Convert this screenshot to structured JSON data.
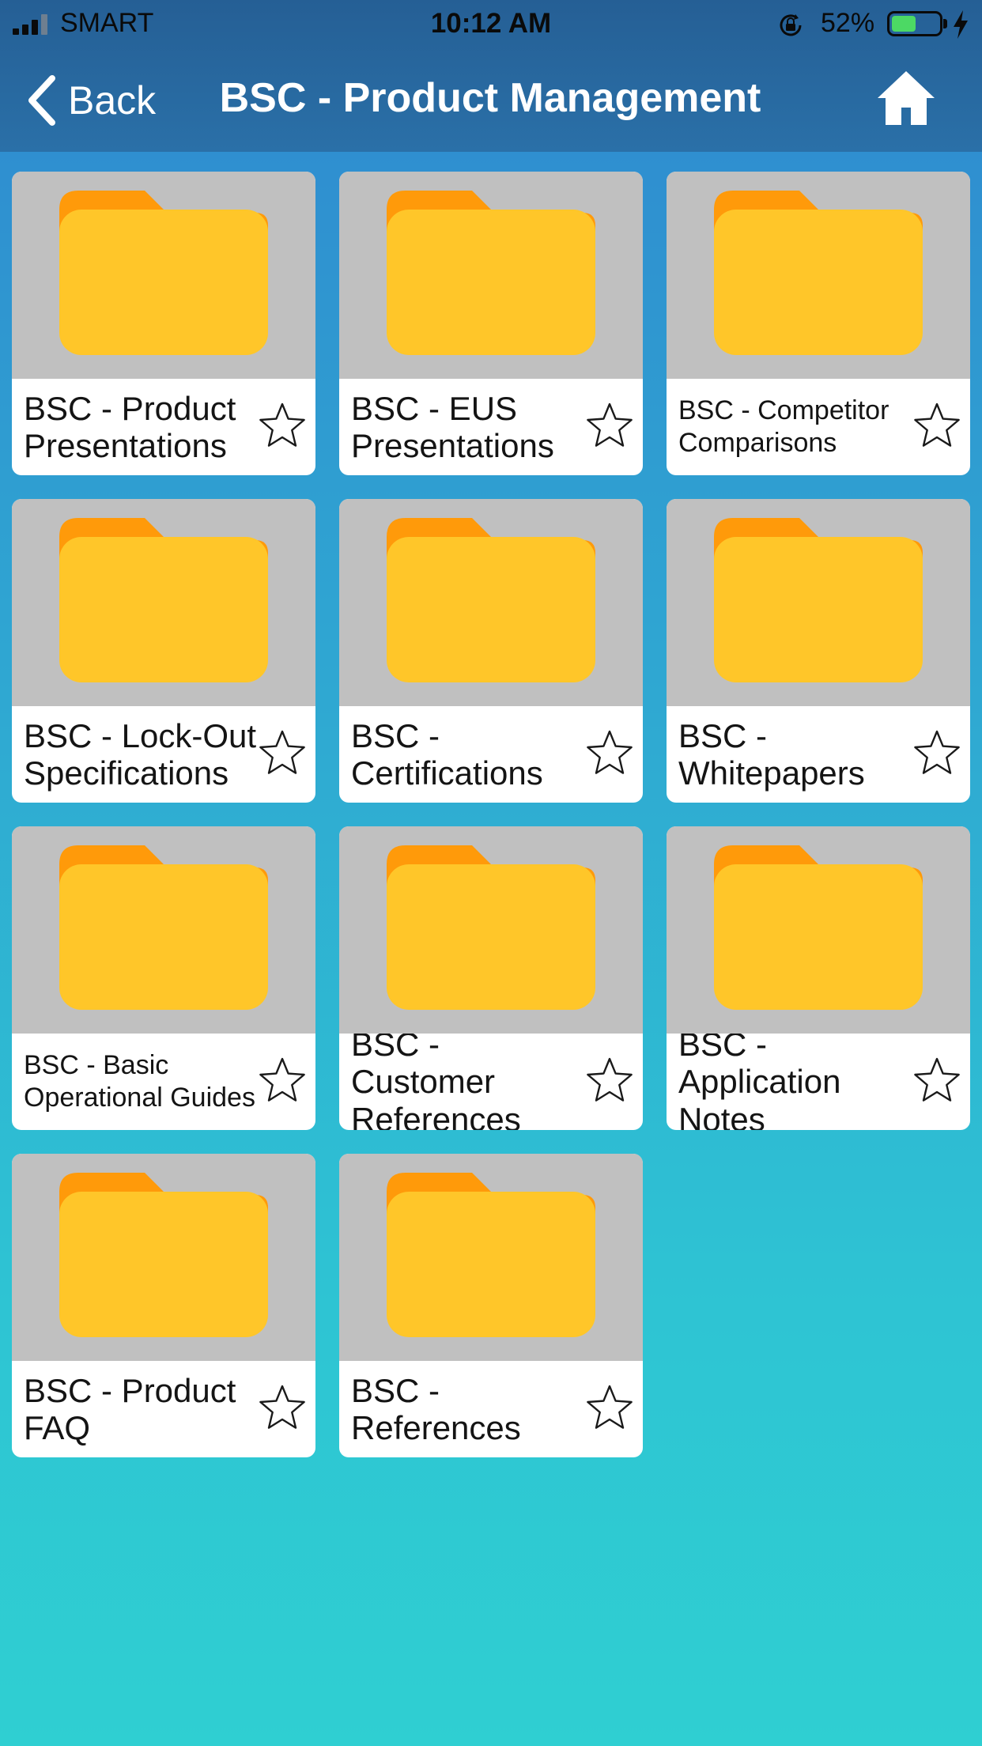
{
  "status_bar": {
    "carrier": "SMART",
    "time": "10:12 AM",
    "battery_percent": "52%",
    "battery_level": 0.52,
    "colors": {
      "battery_fill": "#4cd964"
    }
  },
  "nav": {
    "back_label": "Back",
    "title": "BSC - Product Management",
    "home_icon": "home-icon"
  },
  "theme": {
    "header_bg": "#255f95",
    "background_gradient": [
      "#2f88cf",
      "#2fcfd2"
    ],
    "card_bg": "#ffffff",
    "thumb_bg": "#c0c0c0",
    "folder_front": "#ffc629",
    "folder_tab": "#ff9a0a"
  },
  "folders": [
    {
      "title": "BSC - Product Presentations",
      "favorited": false
    },
    {
      "title": "BSC - EUS Presentations",
      "favorited": false
    },
    {
      "title": "BSC - Competitor Comparisons",
      "favorited": false
    },
    {
      "title": "BSC - Lock-Out Specifications",
      "favorited": false
    },
    {
      "title": "BSC - Certifications",
      "favorited": false
    },
    {
      "title": "BSC - Whitepapers",
      "favorited": false
    },
    {
      "title": "BSC - Basic Operational Guides",
      "favorited": false
    },
    {
      "title": "BSC - Customer References",
      "favorited": false
    },
    {
      "title": "BSC - Application Notes",
      "favorited": false
    },
    {
      "title": "BSC - Product FAQ",
      "favorited": false
    },
    {
      "title": "BSC - References",
      "favorited": false
    }
  ]
}
